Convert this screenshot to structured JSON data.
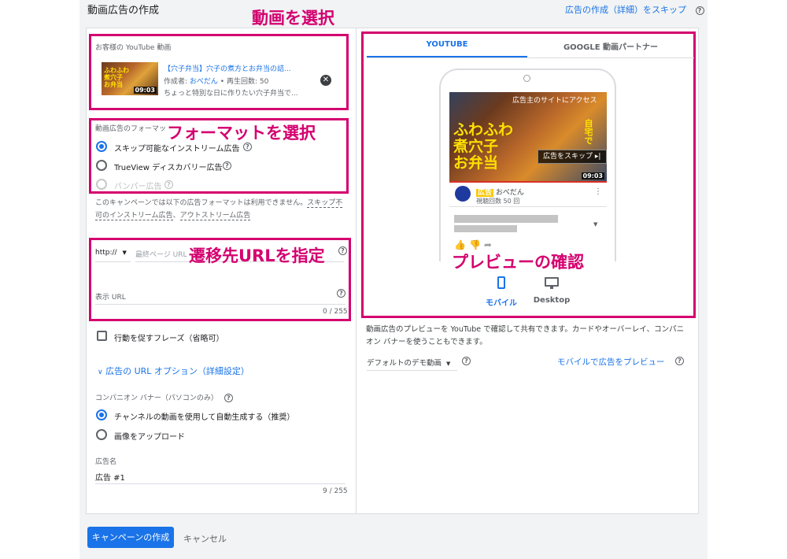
{
  "header": {
    "title": "動画広告の作成",
    "skip_link": "広告の作成（詳細）をスキップ"
  },
  "annotations": {
    "select_video": "動画を選択",
    "select_format": "フォーマットを選択",
    "specify_url": "遷移先URLを指定",
    "preview_check": "プレビューの確認"
  },
  "video": {
    "label": "お客様の YouTube 動画",
    "title": "【穴子弁当】穴子の煮方とお弁当の詰...",
    "author_prefix": "作成者: ",
    "author": "おべだん",
    "views": " • 再生回数: 50",
    "description": "ちょっと特別な日に作りたい穴子弁当で...",
    "duration": "09:03"
  },
  "format": {
    "label": "動画広告のフォーマット",
    "options": [
      {
        "label": "スキップ可能なインストリーム広告",
        "selected": true
      },
      {
        "label": "TrueView ディスカバリー広告",
        "selected": false
      },
      {
        "label": "バンパー広告",
        "selected": false,
        "disabled": true
      }
    ],
    "note_prefix": "このキャンペーンでは以下の広告フォーマットは利用できません。",
    "note_link1": "スキップ不可のインストリーム広告",
    "note_sep": "、",
    "note_link2": "アウトストリーム広告"
  },
  "url": {
    "protocol": "http://",
    "final_url_placeholder": "最終ページ URL",
    "display_url_label": "表示 URL",
    "counter": "0 / 255"
  },
  "cta": {
    "label": "行動を促すフレーズ（省略可）"
  },
  "url_options": {
    "label": "広告の URL オプション（詳細設定）"
  },
  "companion": {
    "label": "コンパニオン バナー（パソコンのみ）",
    "options": [
      {
        "label": "チャンネルの動画を使用して自動生成する（推奨）",
        "selected": true
      },
      {
        "label": "画像をアップロード",
        "selected": false
      }
    ]
  },
  "ad_name": {
    "label": "広告名",
    "value": "広告 #1",
    "counter": "9 / 255"
  },
  "preview": {
    "tabs": [
      "YOUTUBE",
      "GOOGLE 動画パートナー"
    ],
    "active_tab": 0,
    "thumb_caption": "広告主のサイトにアクセス",
    "thumb_overlay_line1": "ふわふわ",
    "thumb_overlay_line2": "煮穴子",
    "thumb_overlay_line3": "お弁当",
    "thumb_overlay_side": "自宅で",
    "skip_button": "広告をスキップ",
    "duration": "09:03",
    "ad_badge": "広告",
    "channel": "おべだん",
    "views": "視聴回数 50 回",
    "devices": [
      {
        "label": "モバイル",
        "icon": "mobile-phone-icon",
        "active": true
      },
      {
        "label": "Desktop",
        "icon": "desktop-monitor-icon",
        "active": false
      }
    ],
    "description": "動画広告のプレビューを YouTube で確認して共有できます。カードやオーバーレイ、コンパニオン バナーを使うこともできます。",
    "demo_select": "デフォルトのデモ動画",
    "mobile_preview_link": "モバイルで広告をプレビュー"
  },
  "footer": {
    "create_button": "キャンペーンの作成",
    "cancel": "キャンセル"
  },
  "colors": {
    "accent": "#1a73e8",
    "annotation": "#d4006f"
  }
}
